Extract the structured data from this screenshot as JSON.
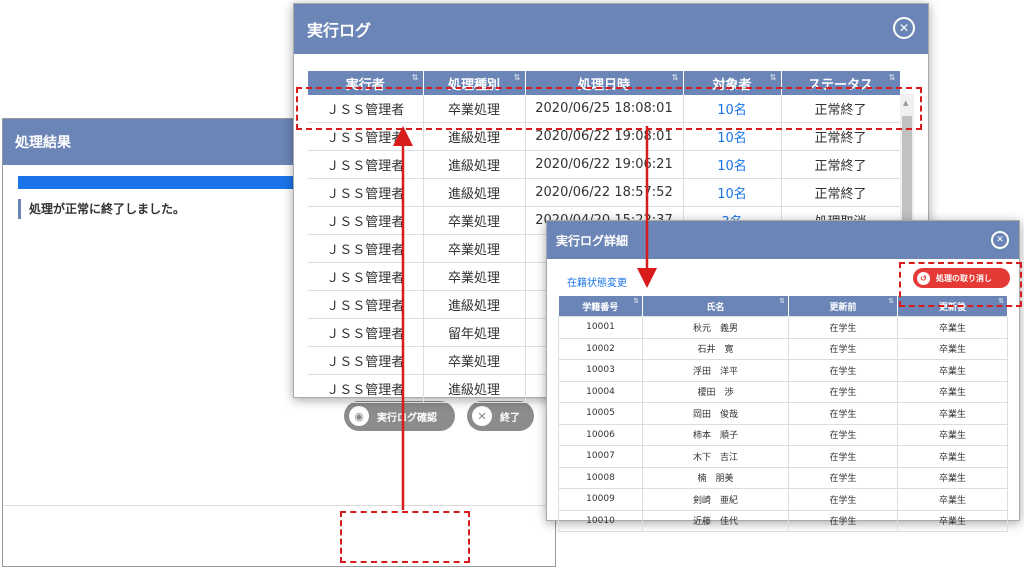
{
  "result_window": {
    "title": "処理結果",
    "message": "処理が正常に終了しました。",
    "progress_percent": 100,
    "log_button_label": "実行ログ確認",
    "end_button_label": "終了"
  },
  "log_window": {
    "title": "実行ログ",
    "columns": [
      "実行者",
      "処理種別",
      "処理日時",
      "対象者",
      "ステータス"
    ],
    "rows": [
      {
        "user": "ＪＳＳ管理者",
        "type": "卒業処理",
        "datetime": "2020/06/25 18:08:01",
        "count": "10名",
        "status": "正常終了"
      },
      {
        "user": "ＪＳＳ管理者",
        "type": "進級処理",
        "datetime": "2020/06/22 19:08:01",
        "count": "10名",
        "status": "正常終了"
      },
      {
        "user": "ＪＳＳ管理者",
        "type": "進級処理",
        "datetime": "2020/06/22 19:06:21",
        "count": "10名",
        "status": "正常終了"
      },
      {
        "user": "ＪＳＳ管理者",
        "type": "進級処理",
        "datetime": "2020/06/22 18:57:52",
        "count": "10名",
        "status": "正常終了"
      },
      {
        "user": "ＪＳＳ管理者",
        "type": "卒業処理",
        "datetime": "2020/04/20 15:22:37",
        "count": "3名",
        "status": "処理取消"
      },
      {
        "user": "ＪＳＳ管理者",
        "type": "卒業処理",
        "datetime": "",
        "count": "",
        "status": ""
      },
      {
        "user": "ＪＳＳ管理者",
        "type": "卒業処理",
        "datetime": "",
        "count": "",
        "status": ""
      },
      {
        "user": "ＪＳＳ管理者",
        "type": "進級処理",
        "datetime": "",
        "count": "",
        "status": ""
      },
      {
        "user": "ＪＳＳ管理者",
        "type": "留年処理",
        "datetime": "",
        "count": "",
        "status": ""
      },
      {
        "user": "ＪＳＳ管理者",
        "type": "卒業処理",
        "datetime": "",
        "count": "",
        "status": ""
      },
      {
        "user": "ＪＳＳ管理者",
        "type": "進級処理",
        "datetime": "",
        "count": "",
        "status": ""
      }
    ]
  },
  "detail_window": {
    "title": "実行ログ詳細",
    "subtitle": "在籍状態変更",
    "undo_button_label": "処理の取り消し",
    "columns": [
      "学籍番号",
      "氏名",
      "更新前",
      "更新後"
    ],
    "rows": [
      {
        "id": "10001",
        "name": "秋元　義男",
        "before": "在学生",
        "after": "卒業生"
      },
      {
        "id": "10002",
        "name": "石井　寛",
        "before": "在学生",
        "after": "卒業生"
      },
      {
        "id": "10003",
        "name": "浮田　洋平",
        "before": "在学生",
        "after": "卒業生"
      },
      {
        "id": "10004",
        "name": "榎田　渉",
        "before": "在学生",
        "after": "卒業生"
      },
      {
        "id": "10005",
        "name": "岡田　俊哉",
        "before": "在学生",
        "after": "卒業生"
      },
      {
        "id": "10006",
        "name": "柿本　順子",
        "before": "在学生",
        "after": "卒業生"
      },
      {
        "id": "10007",
        "name": "木下　吉江",
        "before": "在学生",
        "after": "卒業生"
      },
      {
        "id": "10008",
        "name": "楠　朋美",
        "before": "在学生",
        "after": "卒業生"
      },
      {
        "id": "10009",
        "name": "剣崎　亜紀",
        "before": "在学生",
        "after": "卒業生"
      },
      {
        "id": "10010",
        "name": "近藤　佳代",
        "before": "在学生",
        "after": "卒業生"
      }
    ]
  },
  "colors": {
    "header": "#6b85b6",
    "accent_blue": "#1a73e8",
    "annotation_red": "#d81b1b",
    "undo_red": "#e53935"
  },
  "icons": {
    "close": "close-circle-icon",
    "view": "eye-icon",
    "end": "x-circle-icon",
    "undo": "undo-icon",
    "sort": "sort-arrows-icon"
  }
}
